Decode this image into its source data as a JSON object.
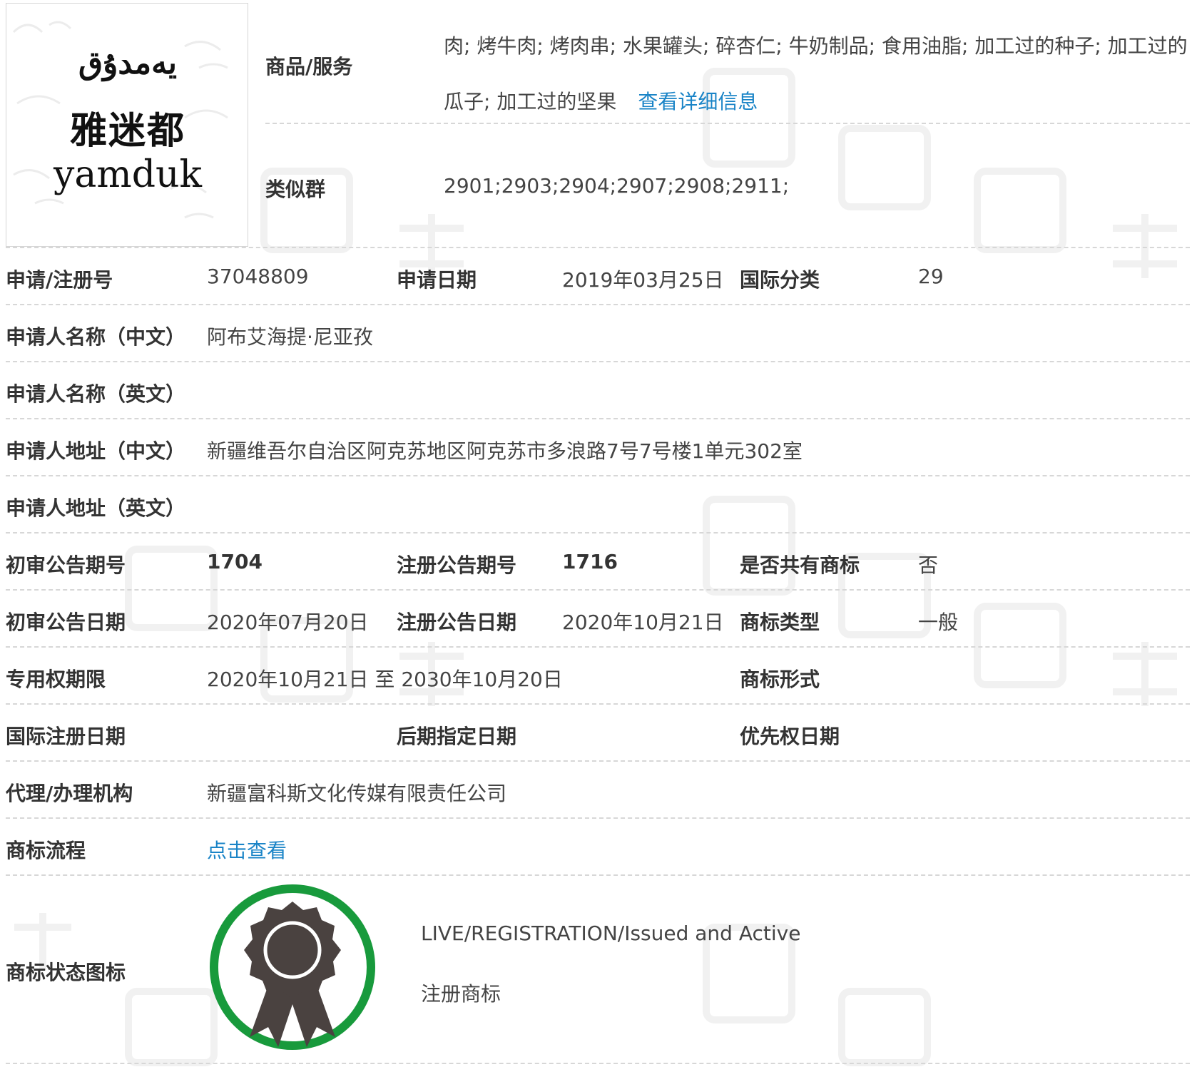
{
  "trademark": {
    "logo_uyghur": "يەمدۇق",
    "logo_chinese": "雅迷都",
    "logo_english": "yamduk"
  },
  "top": {
    "goods_label": "商品/服务",
    "goods_value": "肉; 烤牛肉; 烤肉串; 水果罐头; 碎杏仁; 牛奶制品; 食用油脂; 加工过的种子; 加工过的瓜子; 加工过的坚果",
    "goods_link": "查看详细信息",
    "similar_label": "类似群",
    "similar_value": "2901;2903;2904;2907;2908;2911;"
  },
  "rows": {
    "reg_no_label": "申请/注册号",
    "reg_no": "37048809",
    "app_date_label": "申请日期",
    "app_date": "2019年03月25日",
    "intl_class_label": "国际分类",
    "intl_class": "29",
    "applicant_cn_label": "申请人名称（中文）",
    "applicant_cn": "阿布艾海提·尼亚孜",
    "applicant_en_label": "申请人名称（英文）",
    "address_cn_label": "申请人地址（中文）",
    "address_cn": "新疆维吾尔自治区阿克苏地区阿克苏市多浪路7号7号楼1单元302室",
    "address_en_label": "申请人地址（英文）",
    "prelim_no_label": "初审公告期号",
    "prelim_no": "1704",
    "reg_pub_no_label": "注册公告期号",
    "reg_pub_no": "1716",
    "shared_label": "是否共有商标",
    "shared": "否",
    "prelim_date_label": "初审公告日期",
    "prelim_date": "2020年07月20日",
    "reg_pub_date_label": "注册公告日期",
    "reg_pub_date": "2020年10月21日",
    "tm_type_label": "商标类型",
    "tm_type": "一般",
    "exclusive_label": "专用权期限",
    "exclusive": "2020年10月21日 至 2030年10月20日",
    "tm_form_label": "商标形式",
    "intl_reg_date_label": "国际注册日期",
    "later_date_label": "后期指定日期",
    "priority_date_label": "优先权日期",
    "agency_label": "代理/办理机构",
    "agency": "新疆富科斯文化传媒有限责任公司",
    "process_label": "商标流程",
    "process_link": "点击查看",
    "status_icon_label": "商标状态图标",
    "status_en": "LIVE/REGISTRATION/Issued and Active",
    "status_cn": "注册商标"
  },
  "colors": {
    "link": "#1a84c7",
    "ring": "#189a3c",
    "medal": "#4a4240"
  }
}
